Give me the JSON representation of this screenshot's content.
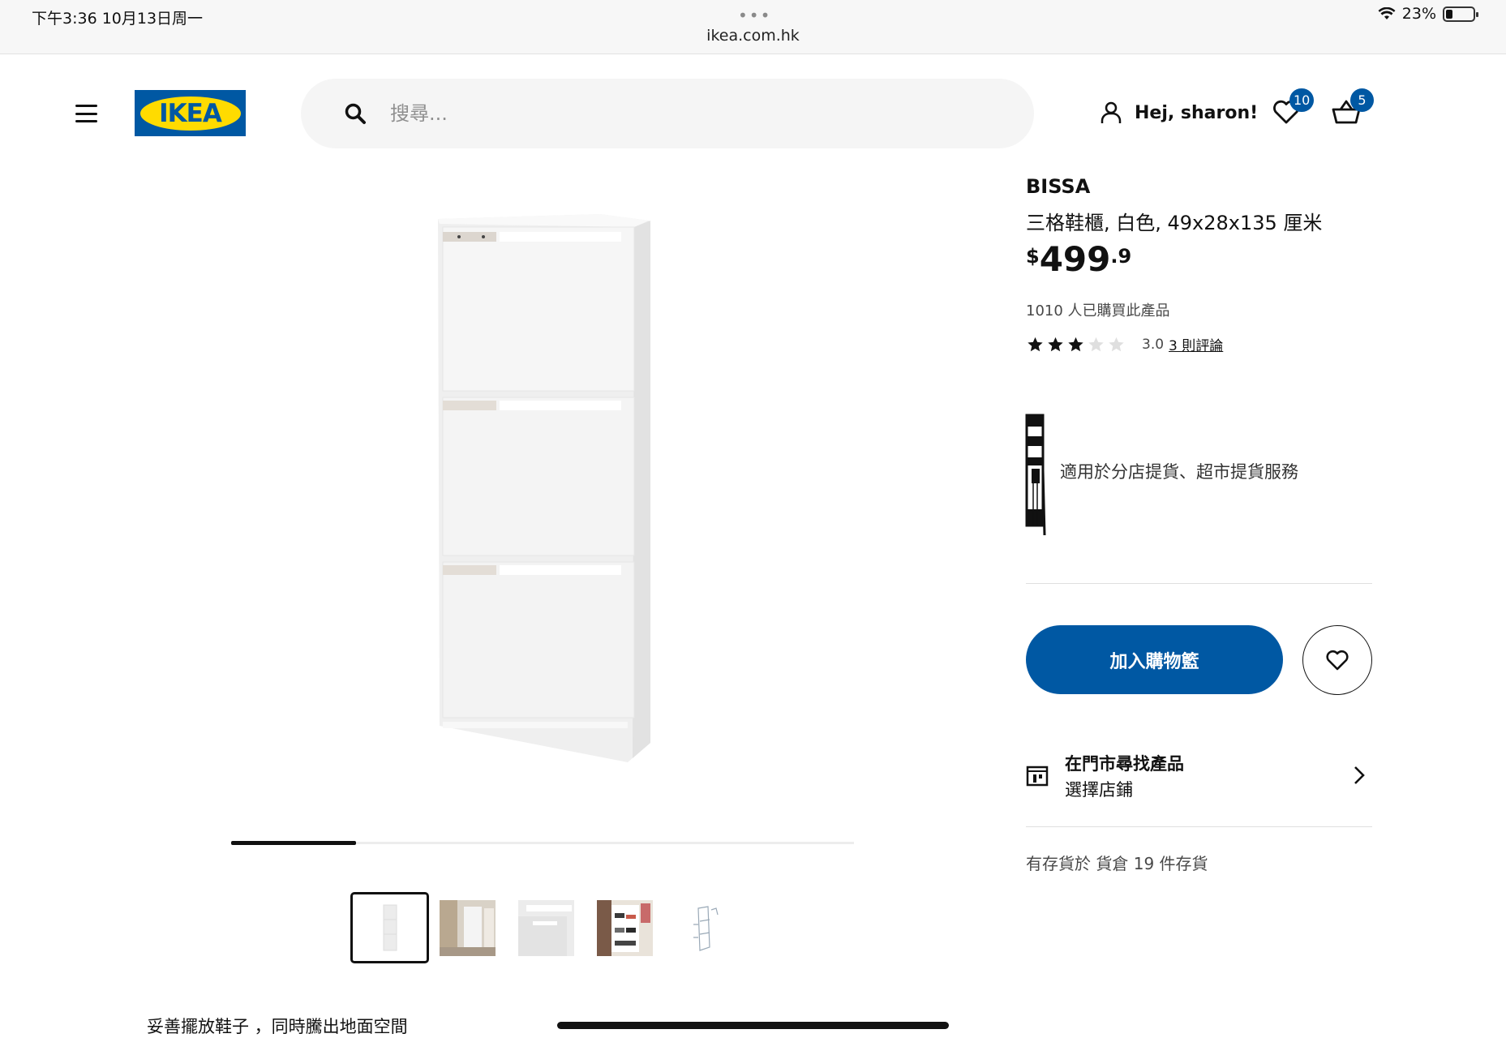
{
  "status_bar": {
    "time": "下午3:36   10月13日周一",
    "dots": "•••",
    "url": "ikea.com.hk",
    "battery": "23%"
  },
  "header": {
    "logo_text": "IKEA",
    "search_placeholder": "搜尋...",
    "greeting": "Hej, sharon!",
    "wishlist_count": "10",
    "cart_count": "5"
  },
  "colors": {
    "brand_blue": "#0058a3",
    "brand_yellow": "#ffdb00"
  },
  "gallery": {
    "progress": 0.2,
    "thumbnails": [
      {
        "name": "thumb-product-front",
        "selected": true
      },
      {
        "name": "thumb-hallway-scene",
        "selected": false
      },
      {
        "name": "thumb-detail-closeup",
        "selected": false
      },
      {
        "name": "thumb-shoes-inside",
        "selected": false
      },
      {
        "name": "thumb-assembly-drawing",
        "selected": false
      }
    ]
  },
  "product": {
    "name": "BISSA",
    "description": "三格鞋櫃, 白色, 49x28x135 厘米",
    "price_currency": "$",
    "price_integer": "499",
    "price_decimal": ".9",
    "bought_count": "1010 人已購買此產品",
    "rating_value": 3.0,
    "rating_text": "3.0",
    "reviews_link": "3 則評論",
    "pickup_text": "適用於分店提貨、超市提貨服務",
    "add_to_cart": "加入購物籃",
    "store_title": "在門市尋找產品",
    "store_subtitle": "選擇店鋪",
    "stock_text": "有存貨於 貨倉 19 件存貨",
    "tagline": "妥善擺放鞋子 ，同時騰出地面空間"
  }
}
